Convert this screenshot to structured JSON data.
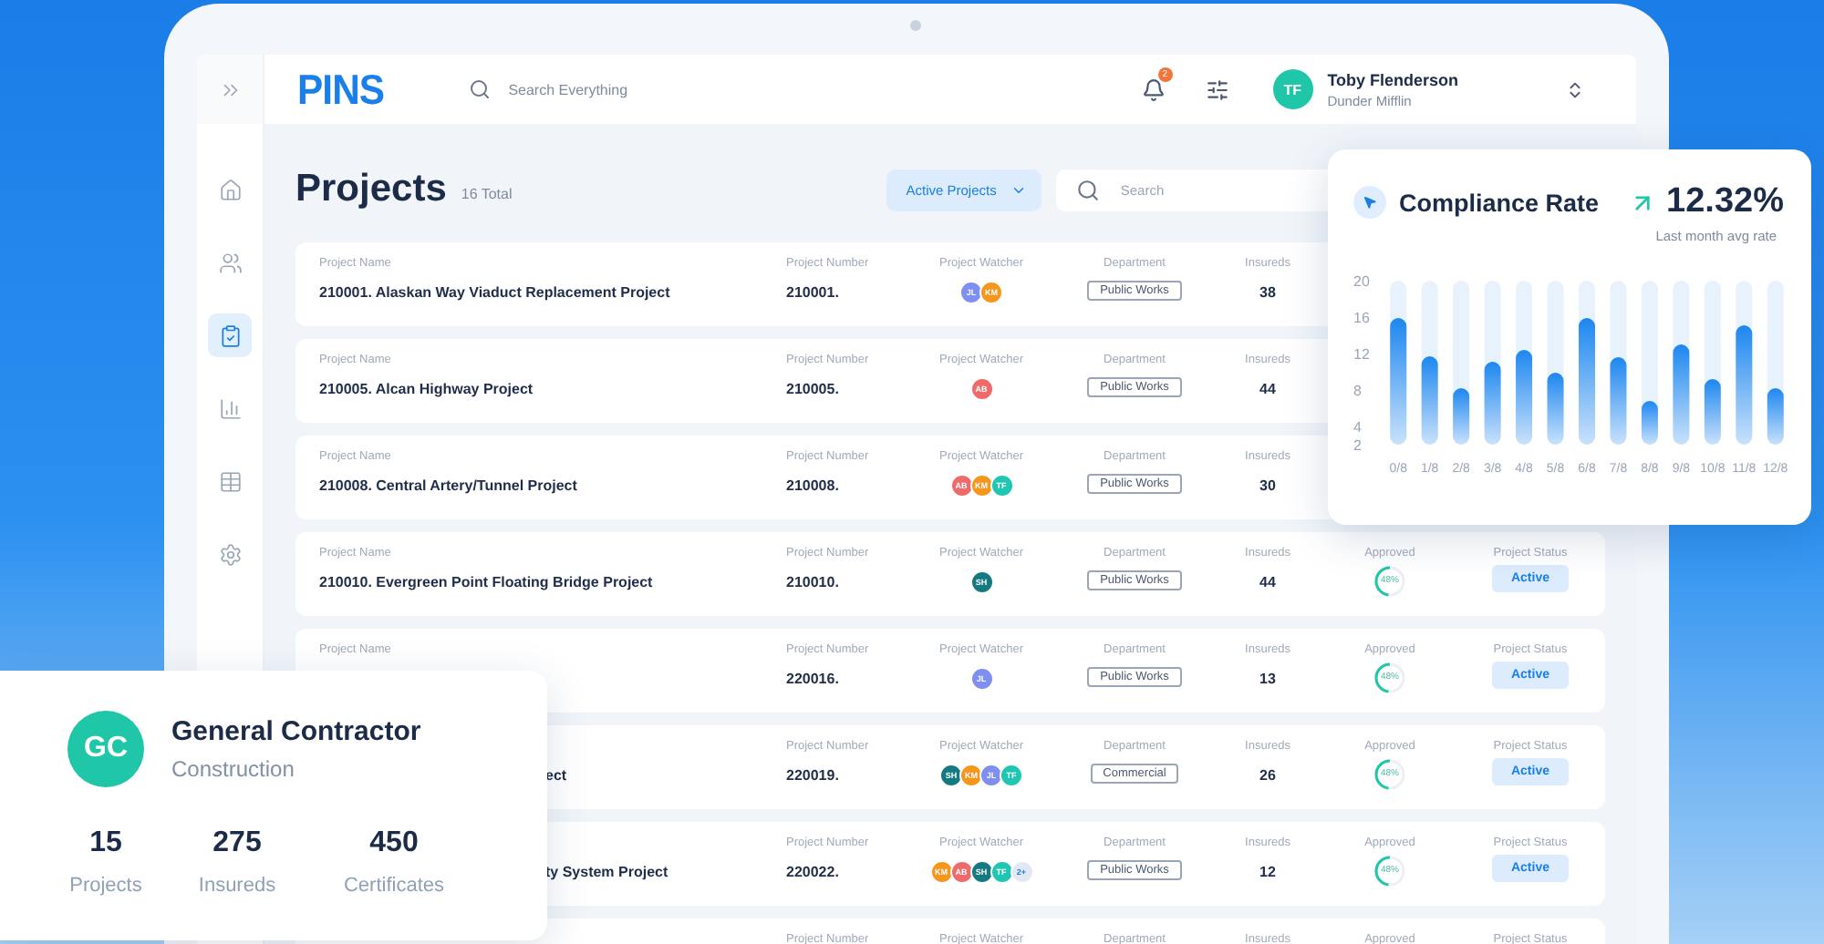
{
  "topbar": {
    "logo": "PINS",
    "search": {
      "placeholder": "Search Everything"
    },
    "notifications": {
      "count": "2"
    },
    "user": {
      "initials": "TF",
      "name": "Toby Flenderson",
      "company": "Dunder Mifflin"
    }
  },
  "sidebar": {
    "items": [
      {
        "selected": false
      },
      {
        "selected": false
      },
      {
        "selected": true
      },
      {
        "selected": false
      },
      {
        "selected": false
      },
      {
        "selected": false
      }
    ]
  },
  "page": {
    "title": "Projects",
    "total": "16 Total",
    "filter": {
      "value": "Active Projects"
    },
    "search": {
      "placeholder": "Search"
    }
  },
  "projects": [
    {
      "name_label": "Project Name",
      "name": "210001. Alaskan Way Viaduct Replacement Project",
      "number_label": "Project Number",
      "number": "210001.",
      "watcher_label": "Project Watcher",
      "watchers": [
        {
          "kind": "person",
          "initials": "JL",
          "color": "#7f8ff0"
        },
        {
          "kind": "person",
          "initials": "KM",
          "color": "#f5961d"
        }
      ],
      "department_label": "Department",
      "department": "Public Works",
      "insureds_label": "Insureds",
      "insureds": "38"
    },
    {
      "name_label": "Project Name",
      "name": "210005. Alcan Highway Project",
      "number_label": "Project Number",
      "number": "210005.",
      "watcher_label": "Project Watcher",
      "watchers": [
        {
          "kind": "person",
          "initials": "AB",
          "color": "#ef6a6a"
        }
      ],
      "department_label": "Department",
      "department": "Public Works",
      "insureds_label": "Insureds",
      "insureds": "44"
    },
    {
      "name_label": "Project Name",
      "name": "210008. Central Artery/Tunnel Project",
      "number_label": "Project Number",
      "number": "210008.",
      "watcher_label": "Project Watcher",
      "watchers": [
        {
          "kind": "person",
          "initials": "AB",
          "color": "#ef6a6a"
        },
        {
          "kind": "person",
          "initials": "KM",
          "color": "#f5961d"
        },
        {
          "kind": "person",
          "initials": "TF",
          "color": "#1fc6b2"
        }
      ],
      "department_label": "Department",
      "department": "Public Works",
      "insureds_label": "Insureds",
      "insureds": "30"
    },
    {
      "name_label": "Project Name",
      "name": "210010. Evergreen Point Floating Bridge Project",
      "number_label": "Project Number",
      "number": "210010.",
      "watcher_label": "Project Watcher",
      "watchers": [
        {
          "kind": "person",
          "initials": "SH",
          "color": "#157a80"
        }
      ],
      "department_label": "Department",
      "department": "Public Works",
      "insureds_label": "Insureds",
      "insureds": "44",
      "approved_label": "Approved",
      "approved": {
        "text": "48%",
        "level": 0.48
      },
      "status_label": "Project Status",
      "status": "Active"
    },
    {
      "name_label": "Project Name",
      "number_label": "Project Number",
      "number": "220016.",
      "watcher_label": "Project Watcher",
      "watchers": [
        {
          "kind": "person",
          "initials": "JL",
          "color": "#7f8ff0"
        }
      ],
      "department_label": "Department",
      "department": "Public Works",
      "insureds_label": "Insureds",
      "insureds": "13",
      "approved_label": "Approved",
      "approved": {
        "text": "48%",
        "level": 0.48
      },
      "status_label": "Project Status",
      "status": "Active"
    },
    {
      "name_tail": "ect",
      "number_label": "Project Number",
      "number": "220019.",
      "watcher_label": "Project Watcher",
      "watchers": [
        {
          "kind": "person",
          "initials": "SH",
          "color": "#157a80"
        },
        {
          "kind": "person",
          "initials": "KM",
          "color": "#f5961d"
        },
        {
          "kind": "person",
          "initials": "JL",
          "color": "#7f8ff0"
        },
        {
          "kind": "person",
          "initials": "TF",
          "color": "#1fc6b2"
        }
      ],
      "department_label": "Department",
      "department": "Commercial",
      "insureds_label": "Insureds",
      "insureds": "26",
      "approved_label": "Approved",
      "approved": {
        "text": "48%",
        "level": 0.48
      },
      "status_label": "Project Status",
      "status": "Active"
    },
    {
      "name_tail": "ty System Project",
      "number_label": "Project Number",
      "number": "220022.",
      "watcher_label": "Project Watcher",
      "watchers": [
        {
          "kind": "person",
          "initials": "KM",
          "color": "#f5961d"
        },
        {
          "kind": "person",
          "initials": "AB",
          "color": "#ef6a6a"
        },
        {
          "kind": "person",
          "initials": "SH",
          "color": "#157a80"
        },
        {
          "kind": "person",
          "initials": "TF",
          "color": "#1fc6b2"
        },
        {
          "kind": "more",
          "initials": "2+",
          "color": "#e3e9f3"
        }
      ],
      "department_label": "Department",
      "department": "Public Works",
      "insureds_label": "Insureds",
      "insureds": "12",
      "approved_label": "Approved",
      "approved": {
        "text": "48%",
        "level": 0.48
      },
      "status_label": "Project Status",
      "status": "Active"
    },
    {
      "number_label": "Project Number",
      "watcher_label": "Project Watcher",
      "department_label": "Department",
      "insureds_label": "Insureds",
      "approved_label": "Approved",
      "status_label": "Project Status"
    }
  ],
  "compliance_card": {
    "title": "Compliance Rate",
    "rate": "12.32%",
    "caption": "Last month avg rate",
    "chart_data": {
      "type": "bar",
      "categories": [
        "0/8",
        "1/8",
        "2/8",
        "3/8",
        "4/8",
        "5/8",
        "6/8",
        "7/8",
        "8/8",
        "9/8",
        "10/8",
        "11/8",
        "12/8"
      ],
      "values": [
        15.9,
        11.7,
        8.2,
        11.1,
        12.4,
        9.9,
        15.9,
        11.6,
        6.8,
        13,
        9.2,
        15.1,
        8.2
      ],
      "ylim": [
        2,
        20
      ],
      "yticks": [
        2,
        4,
        8,
        12,
        16,
        20
      ]
    }
  },
  "contractor_card": {
    "initials": "GC",
    "title": "General Contractor",
    "subtitle": "Construction",
    "stats": [
      {
        "value": "15",
        "label": "Projects"
      },
      {
        "value": "275",
        "label": "Insureds"
      },
      {
        "value": "450",
        "label": "Certificates"
      }
    ]
  }
}
